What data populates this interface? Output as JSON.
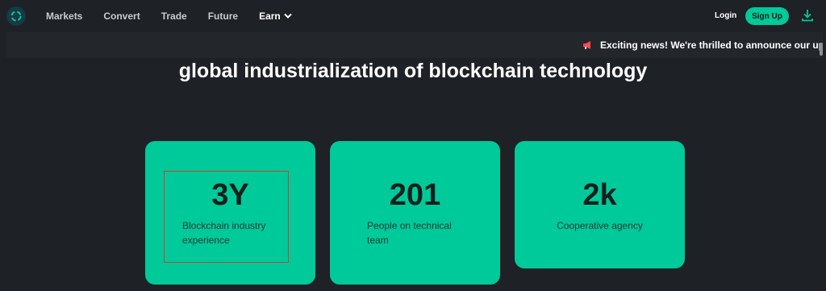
{
  "nav": {
    "items": [
      {
        "label": "Markets"
      },
      {
        "label": "Convert"
      },
      {
        "label": "Trade"
      },
      {
        "label": "Future"
      },
      {
        "label": "Earn"
      }
    ],
    "login_label": "Login",
    "signup_label": "Sign Up",
    "accent_color": "#00c99a"
  },
  "ticker": {
    "text": "Exciting news! We're thrilled to announce our upc"
  },
  "headline": "global industrialization of blockchain technology",
  "stats": [
    {
      "value": "3Y",
      "label": "Blockchain industry experience"
    },
    {
      "value": "201",
      "label": "People on technical team"
    },
    {
      "value": "2k",
      "label": "Cooperative agency"
    }
  ]
}
